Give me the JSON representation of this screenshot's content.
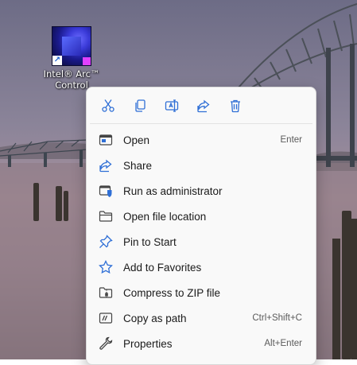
{
  "desktop": {
    "app_icon": {
      "label_line1": "Intel® Arc™",
      "label_line2": "Control",
      "icon": "intel-arc-app-icon"
    }
  },
  "context_menu": {
    "toolbar": [
      {
        "icon": "cut-icon"
      },
      {
        "icon": "copy-icon"
      },
      {
        "icon": "rename-icon"
      },
      {
        "icon": "share-icon"
      },
      {
        "icon": "delete-icon"
      }
    ],
    "items": [
      {
        "label": "Open",
        "shortcut": "Enter",
        "icon": "open-icon"
      },
      {
        "label": "Share",
        "shortcut": "",
        "icon": "share-icon"
      },
      {
        "label": "Run as administrator",
        "shortcut": "",
        "icon": "admin-shield-icon"
      },
      {
        "label": "Open file location",
        "shortcut": "",
        "icon": "folder-icon"
      },
      {
        "label": "Pin to Start",
        "shortcut": "",
        "icon": "pin-icon"
      },
      {
        "label": "Add to Favorites",
        "shortcut": "",
        "icon": "star-icon"
      },
      {
        "label": "Compress to ZIP file",
        "shortcut": "",
        "icon": "zip-icon"
      },
      {
        "label": "Copy as path",
        "shortcut": "Ctrl+Shift+C",
        "icon": "copy-path-icon"
      },
      {
        "label": "Properties",
        "shortcut": "Alt+Enter",
        "icon": "wrench-icon"
      }
    ]
  },
  "colors": {
    "accent": "#2f6fd6",
    "menu_bg": "#f9f9f9",
    "text": "#1a1a1a"
  }
}
